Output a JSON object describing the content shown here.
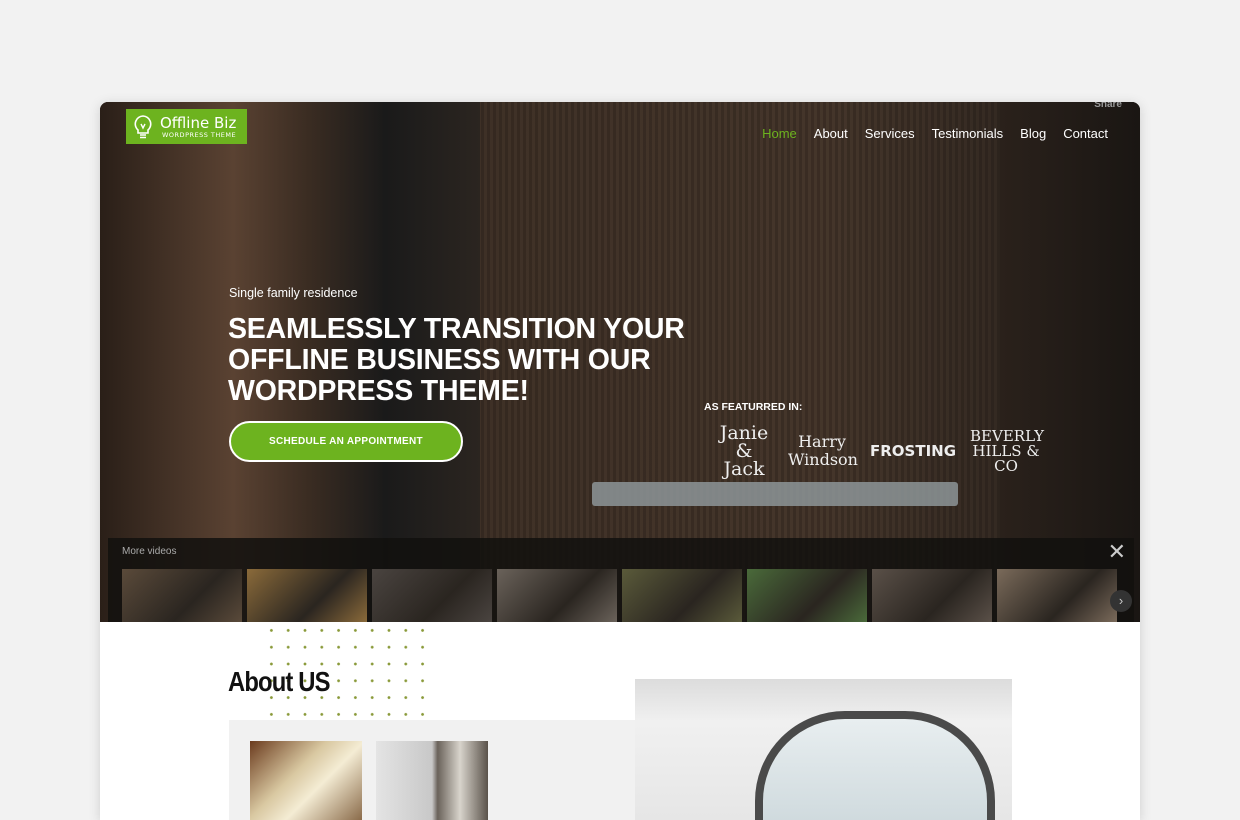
{
  "logo": {
    "title": "Offline Biz",
    "subtitle": "WORDPRESS THEME"
  },
  "share_label": "Share",
  "nav": [
    {
      "label": "Home",
      "active": true
    },
    {
      "label": "About"
    },
    {
      "label": "Services"
    },
    {
      "label": "Testimonials"
    },
    {
      "label": "Blog"
    },
    {
      "label": "Contact"
    }
  ],
  "hero": {
    "eyebrow": "Single family residence",
    "headline": "SEAMLESSLY TRANSITION YOUR OFFLINE BUSINESS WITH OUR WORDPRESS THEME!",
    "cta": "SCHEDULE AN APPOINTMENT",
    "featured_label": "AS FEATURRED IN:",
    "brands": [
      "Janie & Jack",
      "Harry Windson",
      "FROSTING",
      "BEVERLY HILLS & CO"
    ]
  },
  "videos": {
    "label": "More videos",
    "close_icon": "close-icon",
    "next_icon": "chevron-right-icon",
    "thumb_colors": [
      "#5a4a3a",
      "#8a6a3a",
      "#4a4440",
      "#6a625a",
      "#5a5a3a",
      "#4a6a3a",
      "#5a5048",
      "#7a6a5a"
    ]
  },
  "about": {
    "title": "About US"
  },
  "colors": {
    "accent": "#6db31f",
    "page_bg": "#f2f2f2"
  }
}
